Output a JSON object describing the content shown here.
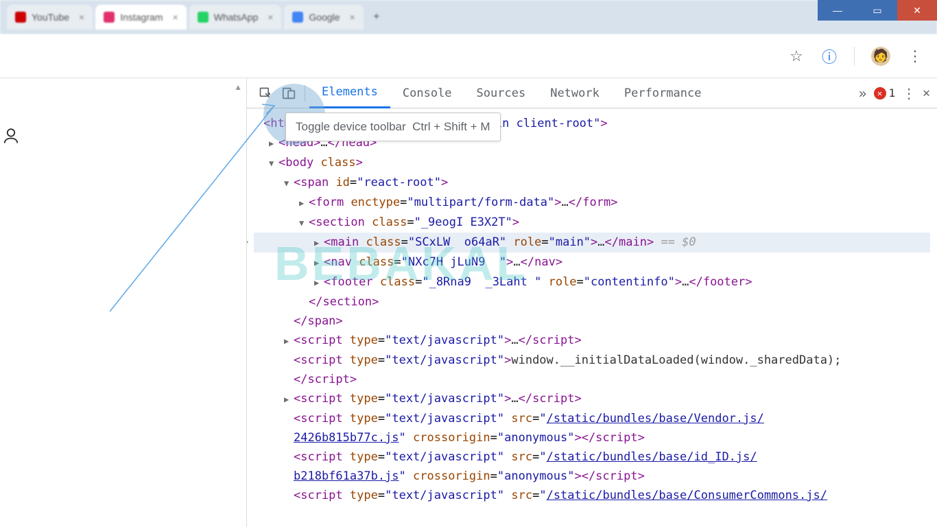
{
  "window_controls": {
    "min": "—",
    "max": "▭",
    "close": "✕"
  },
  "tabs": [
    {
      "title": "YouTube",
      "favicon": "#cc0000"
    },
    {
      "title": "Instagram",
      "favicon": "#e1306c",
      "active": true
    },
    {
      "title": "WhatsApp",
      "favicon": "#25d366"
    },
    {
      "title": "Google",
      "favicon": "#4285f4"
    }
  ],
  "toolbar": {
    "star": "☆",
    "ext_icon": "ⓘ",
    "menu": "⋮"
  },
  "devtools": {
    "tabs": [
      "Elements",
      "Console",
      "Sources",
      "Network",
      "Performance"
    ],
    "active_tab": "Elements",
    "more": "»",
    "error_count": "1",
    "menu": "⋮",
    "close": "✕",
    "tooltip_label": "Toggle device toolbar",
    "tooltip_shortcut": "Ctrl + Shift + M"
  },
  "dom": {
    "l1": {
      "open": "<html lang=\"id\" class=\"js logged-in client-root\">"
    },
    "l2": {
      "open": "<head>",
      "ell": "…",
      "close": "</head>"
    },
    "l3": {
      "open": "<body class>"
    },
    "l4": {
      "open": "<span id=\"react-root\">"
    },
    "l5": {
      "open": "<form enctype=\"multipart/form-data\">",
      "ell": "…",
      "close": "</form>"
    },
    "l6": {
      "open": "<section class=\"_9eogI E3X2T\">"
    },
    "l7": {
      "open": "<main class=\"SCxLW  o64aR\" role=\"main\">",
      "ell": "…",
      "close": "</main>",
      "dollar": " == $0"
    },
    "l8": {
      "open": "<nav class=\"NXc7H jLuN9  \">",
      "ell": "…",
      "close": "</nav>"
    },
    "l9": {
      "open": "<footer class=\"_8Rna9  _3Laht \" role=\"contentinfo\">",
      "ell": "…",
      "close": "</footer>"
    },
    "l10": {
      "close": "</section>"
    },
    "l11": {
      "close": "</span>"
    },
    "l12": {
      "open": "<script type=\"text/javascript\">",
      "ell": "…",
      "close": "</​script>"
    },
    "l13a": {
      "open": "<script type=\"text/javascript\">",
      "txt": "window.__initialDataLoaded(window._sharedData);"
    },
    "l13b": {
      "close": "</​script>"
    },
    "l14": {
      "open": "<script type=\"text/javascript\">",
      "ell": "…",
      "close": "</​script>"
    },
    "l15a": {
      "open": "<script type=\"text/javascript\" src=\"",
      "link": "/static/bundles/base/Vendor.js/"
    },
    "l15b": {
      "link": "2426b815b77c.js",
      "mid": "\" crossorigin=\"anonymous\">",
      "close": "</​script>"
    },
    "l16a": {
      "open": "<script type=\"text/javascript\" src=\"",
      "link": "/static/bundles/base/id_ID.js/"
    },
    "l16b": {
      "link": "b218bf61a37b.js",
      "mid": "\" crossorigin=\"anonymous\">",
      "close": "</​script>"
    },
    "l17": {
      "open": "<script type=\"text/javascript\" src=\"",
      "link": "/static/bundles/base/ConsumerCommons.js/"
    }
  },
  "watermark": "BEBAKAL"
}
